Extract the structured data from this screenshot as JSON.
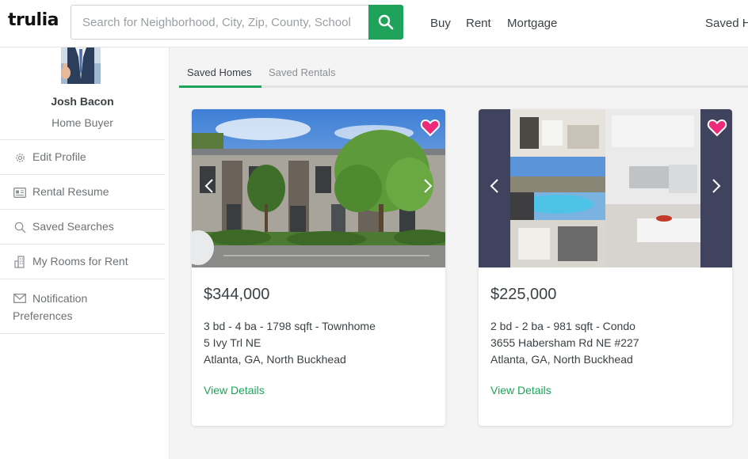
{
  "header": {
    "logo": "trulia",
    "search_placeholder": "Search for Neighborhood, City, Zip, County, School",
    "nav": [
      "Buy",
      "Rent",
      "Mortgage"
    ],
    "saved_link": "Saved H"
  },
  "sidebar": {
    "user_name": "Josh Bacon",
    "user_role": "Home Buyer",
    "items": [
      {
        "label": "Edit Profile",
        "icon": "gear-icon"
      },
      {
        "label": "Rental Resume",
        "icon": "id-card-icon"
      },
      {
        "label": "Saved Searches",
        "icon": "search-icon"
      },
      {
        "label": "My Rooms for Rent",
        "icon": "building-icon"
      },
      {
        "label": "Notification",
        "label2": "Preferences",
        "icon": "envelope-icon"
      }
    ]
  },
  "tabs": [
    {
      "label": "Saved Homes",
      "active": true
    },
    {
      "label": "Saved Rentals",
      "active": false
    }
  ],
  "listings": [
    {
      "price": "$344,000",
      "specs": "3 bd - 4 ba - 1798 sqft - Townhome",
      "address": "5 Ivy Trl NE",
      "location": "Atlanta, GA, North Buckhead",
      "link": "View Details"
    },
    {
      "price": "$225,000",
      "specs": "2 bd - 2 ba - 981 sqft - Condo",
      "address": "3655 Habersham Rd NE #227",
      "location": "Atlanta, GA, North Buckhead",
      "link": "View Details"
    }
  ],
  "colors": {
    "brand_green": "#1fa35b",
    "heart_pink": "#ee2b7a",
    "text": "#3b4144",
    "muted": "#6d7275"
  }
}
